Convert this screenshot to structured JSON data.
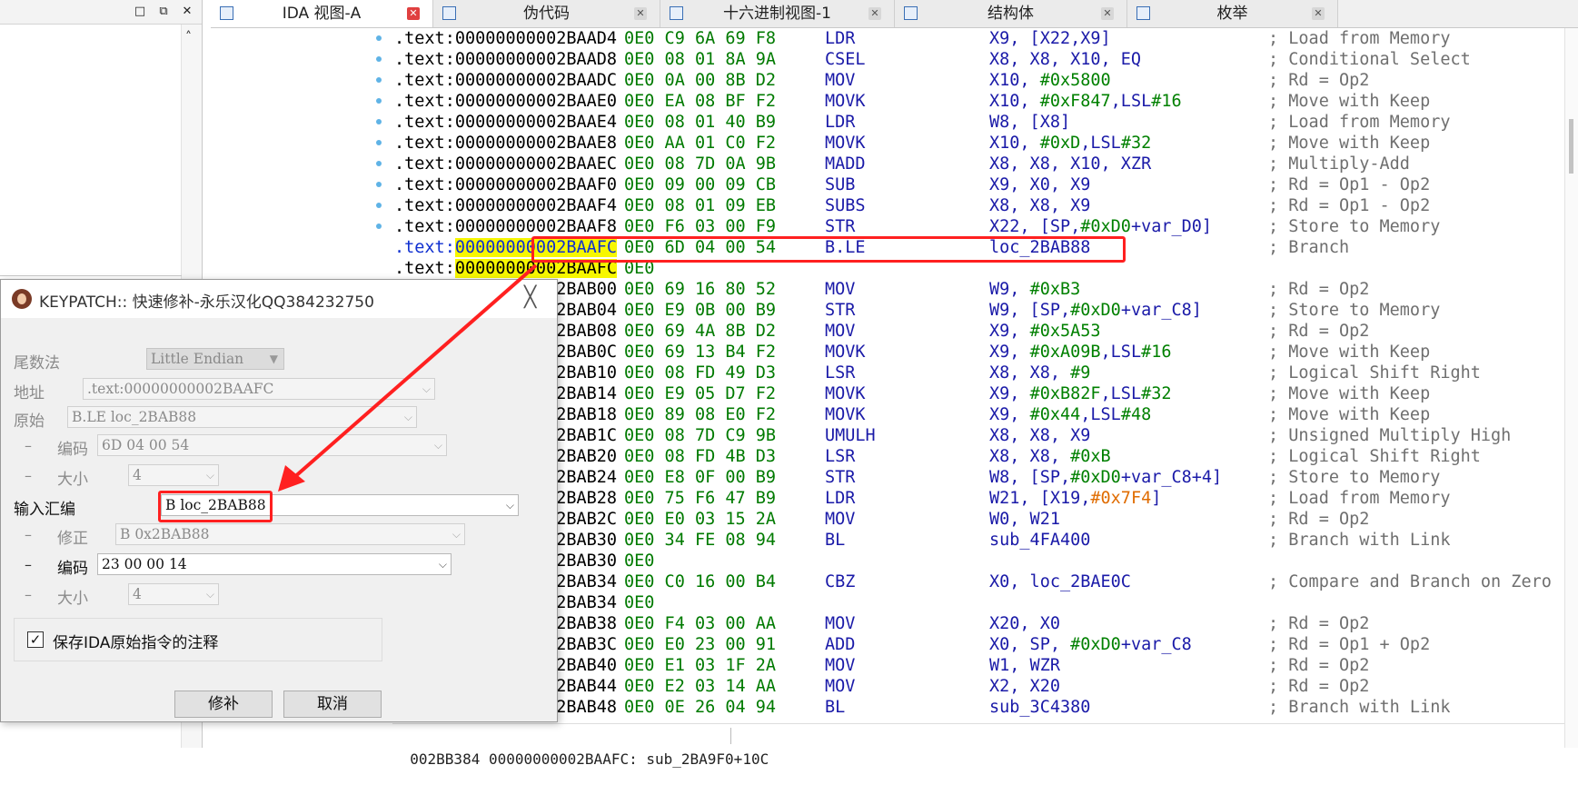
{
  "left_panel": {
    "restore_glyph": "□",
    "max_glyph": "⧉",
    "close_glyph": "✕",
    "scroll_up_glyph": "˄"
  },
  "tabs": [
    {
      "label": "IDA 视图-A",
      "icon": "ida-view-icon",
      "active": true
    },
    {
      "label": "伪代码",
      "icon": "pseudocode-icon",
      "active": false
    },
    {
      "label": "十六进制视图-1",
      "icon": "hex-view-icon",
      "active": false
    },
    {
      "label": "结构体",
      "icon": "structures-icon",
      "active": false
    },
    {
      "label": "枚举",
      "icon": "enums-icon",
      "active": false
    }
  ],
  "tab_close_glyph": "✕",
  "code_lines": [
    {
      "addr": ".text:00000000002BAAD4",
      "bytes": "0E0 C9 6A 69 F8",
      "mn": "LDR",
      "op": "X9, [X22,X9]",
      "cm": "; Load from Memory"
    },
    {
      "addr": ".text:00000000002BAAD8",
      "bytes": "0E0 08 01 8A 9A",
      "mn": "CSEL",
      "op": "X8, X8, X10, EQ",
      "cm": "; Conditional Select"
    },
    {
      "addr": ".text:00000000002BAADC",
      "bytes": "0E0 0A 00 8B D2",
      "mn": "MOV",
      "op": "X10, #0x5800",
      "cm": "; Rd = Op2"
    },
    {
      "addr": ".text:00000000002BAAE0",
      "bytes": "0E0 EA 08 BF F2",
      "mn": "MOVK",
      "op": "X10, #0xF847,LSL#16",
      "cm": "; Move with Keep"
    },
    {
      "addr": ".text:00000000002BAAE4",
      "bytes": "0E0 08 01 40 B9",
      "mn": "LDR",
      "op": "W8, [X8]",
      "cm": "; Load from Memory"
    },
    {
      "addr": ".text:00000000002BAAE8",
      "bytes": "0E0 AA 01 C0 F2",
      "mn": "MOVK",
      "op": "X10, #0xD,LSL#32",
      "cm": "; Move with Keep"
    },
    {
      "addr": ".text:00000000002BAAEC",
      "bytes": "0E0 08 7D 0A 9B",
      "mn": "MADD",
      "op": "X8, X8, X10, XZR",
      "cm": "; Multiply-Add"
    },
    {
      "addr": ".text:00000000002BAAF0",
      "bytes": "0E0 09 00 09 CB",
      "mn": "SUB",
      "op": "X9, X0, X9",
      "cm": "; Rd = Op1 - Op2"
    },
    {
      "addr": ".text:00000000002BAAF4",
      "bytes": "0E0 08 01 09 EB",
      "mn": "SUBS",
      "op": "X8, X8, X9",
      "cm": "; Rd = Op1 - Op2"
    },
    {
      "addr": ".text:00000000002BAAF8",
      "bytes": "0E0 F6 03 00 F9",
      "mn": "STR",
      "op": "X22, [SP,#0xD0+var_D0]",
      "cm": "; Store to Memory"
    },
    {
      "addr": ".text:00000000002BAAFC",
      "bytes": "0E0 6D 04 00 54",
      "mn": "B.LE",
      "op": "loc_2BAB88",
      "cm": "; Branch"
    },
    {
      "addr": ".text:00000000002BAAFC",
      "bytes": "0E0",
      "mn": "",
      "op": "",
      "cm": ""
    },
    {
      "addr": ".text:00000000002BAB00",
      "bytes": "0E0 69 16 80 52",
      "mn": "MOV",
      "op": "W9, #0xB3",
      "cm": "; Rd = Op2"
    },
    {
      "addr": ".text:00000000002BAB04",
      "bytes": "0E0 E9 0B 00 B9",
      "mn": "STR",
      "op": "W9, [SP,#0xD0+var_C8]",
      "cm": "; Store to Memory"
    },
    {
      "addr": ".text:00000000002BAB08",
      "bytes": "0E0 69 4A 8B D2",
      "mn": "MOV",
      "op": "X9, #0x5A53",
      "cm": "; Rd = Op2"
    },
    {
      "addr": ".text:00000000002BAB0C",
      "bytes": "0E0 69 13 B4 F2",
      "mn": "MOVK",
      "op": "X9, #0xA09B,LSL#16",
      "cm": "; Move with Keep"
    },
    {
      "addr": ".text:00000000002BAB10",
      "bytes": "0E0 08 FD 49 D3",
      "mn": "LSR",
      "op": "X8, X8, #9",
      "cm": "; Logical Shift Right"
    },
    {
      "addr": ".text:00000000002BAB14",
      "bytes": "0E0 E9 05 D7 F2",
      "mn": "MOVK",
      "op": "X9, #0xB82F,LSL#32",
      "cm": "; Move with Keep"
    },
    {
      "addr": ".text:00000000002BAB18",
      "bytes": "0E0 89 08 E0 F2",
      "mn": "MOVK",
      "op": "X9, #0x44,LSL#48",
      "cm": "; Move with Keep"
    },
    {
      "addr": ".text:00000000002BAB1C",
      "bytes": "0E0 08 7D C9 9B",
      "mn": "UMULH",
      "op": "X8, X8, X9",
      "cm": "; Unsigned Multiply High"
    },
    {
      "addr": ".text:00000000002BAB20",
      "bytes": "0E0 08 FD 4B D3",
      "mn": "LSR",
      "op": "X8, X8, #0xB",
      "cm": "; Logical Shift Right"
    },
    {
      "addr": ".text:00000000002BAB24",
      "bytes": "0E0 E8 0F 00 B9",
      "mn": "STR",
      "op": "W8, [SP,#0xD0+var_C8+4]",
      "cm": "; Store to Memory"
    },
    {
      "addr": ".text:00000000002BAB28",
      "bytes": "0E0 75 F6 47 B9",
      "mn": "LDR",
      "op": "W21, [X19,#0x7F4]",
      "cm": "; Load from Memory"
    },
    {
      "addr": ".text:00000000002BAB2C",
      "bytes": "0E0 E0 03 15 2A",
      "mn": "MOV",
      "op": "W0, W21",
      "cm": "; Rd = Op2"
    },
    {
      "addr": ".text:00000000002BAB30",
      "bytes": "0E0 34 FE 08 94",
      "mn": "BL",
      "op": "sub_4FA400",
      "cm": "; Branch with Link"
    },
    {
      "addr": ".text:00000000002BAB30",
      "bytes": "0E0",
      "mn": "",
      "op": "",
      "cm": ""
    },
    {
      "addr": ".text:00000000002BAB34",
      "bytes": "0E0 C0 16 00 B4",
      "mn": "CBZ",
      "op": "X0, loc_2BAE0C",
      "cm": "; Compare and Branch on Zero"
    },
    {
      "addr": ".text:00000000002BAB34",
      "bytes": "0E0",
      "mn": "",
      "op": "",
      "cm": ""
    },
    {
      "addr": ".text:00000000002BAB38",
      "bytes": "0E0 F4 03 00 AA",
      "mn": "MOV",
      "op": "X20, X0",
      "cm": "; Rd = Op2"
    },
    {
      "addr": ".text:00000000002BAB3C",
      "bytes": "0E0 E0 23 00 91",
      "mn": "ADD",
      "op": "X0, SP, #0xD0+var_C8",
      "cm": "; Rd = Op1 + Op2"
    },
    {
      "addr": ".text:00000000002BAB40",
      "bytes": "0E0 E1 03 1F 2A",
      "mn": "MOV",
      "op": "W1, WZR",
      "cm": "; Rd = Op2"
    },
    {
      "addr": ".text:00000000002BAB44",
      "bytes": "0E0 E2 03 14 AA",
      "mn": "MOV",
      "op": "X2, X20",
      "cm": "; Rd = Op2"
    },
    {
      "addr": ".text:00000000002BAB48",
      "bytes": "0E0 0E 26 04 94",
      "mn": "BL",
      "op": "sub_3C4380",
      "cm": "; Branch with Link"
    }
  ],
  "status_bar": {
    "text": "002BB384 00000000002BAAFC: sub_2BA9F0+10C"
  },
  "dialog": {
    "title": "KEYPATCH:: 快速修补-永乐汉化QQ384232750",
    "close_glyph": "╳",
    "endian_label": "尾数法",
    "endian_value": "Little Endian",
    "address_label": "地址",
    "address_value": ".text:00000000002BAAFC",
    "original_label": "原始",
    "original_value": "B.LE loc_2BAB88",
    "orig_encoding_label": "编码",
    "orig_encoding_value": "6D 04 00 54",
    "orig_size_label": "大小",
    "orig_size_value": "4",
    "asm_label": "输入汇编",
    "asm_value": "B loc_2BAB88",
    "fixup_label": "修正",
    "fixup_value": "B 0x2BAB88",
    "new_encoding_label": "编码",
    "new_encoding_value": "23 00 00 14",
    "new_size_label": "大小",
    "new_size_value": "4",
    "dash": "–",
    "checkbox_checked": true,
    "checkbox_glyph": "✓",
    "checkbox_label": "保存IDA原始指令的注释",
    "patch_button": "修补",
    "cancel_button": "取消"
  },
  "colors": {
    "annotation_red": "#ff2020",
    "highlight_yellow": "#f7f700",
    "bytes_green": "#007a00",
    "mnemonic_blue": "#1a1aa8"
  }
}
